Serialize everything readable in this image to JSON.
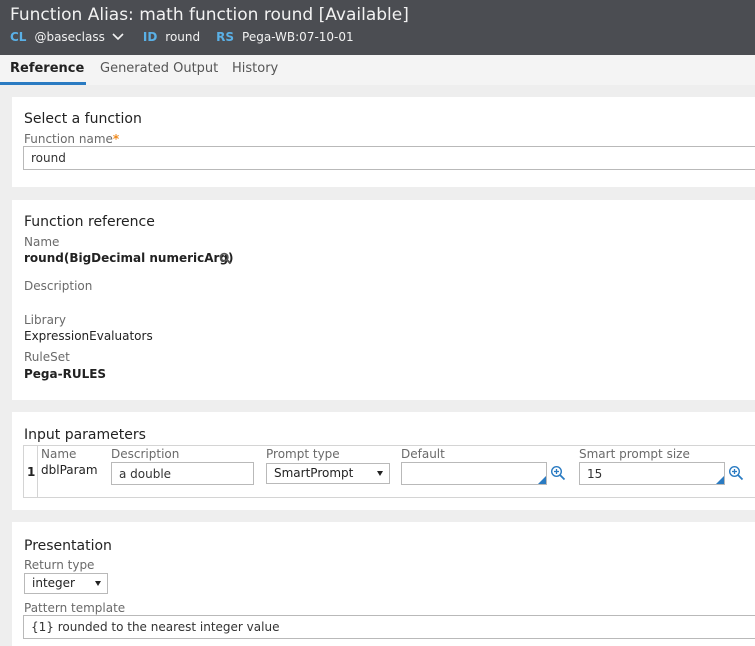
{
  "header": {
    "title": "Function Alias: math function round [Available]",
    "cl_key": "CL",
    "cl_value": "@baseclass",
    "id_key": "ID",
    "id_value": "round",
    "rs_key": "RS",
    "rs_value": "Pega-WB:07-10-01"
  },
  "tabs": [
    {
      "label": "Reference",
      "active": true
    },
    {
      "label": "Generated Output",
      "active": false
    },
    {
      "label": "History",
      "active": false
    }
  ],
  "select_function": {
    "title": "Select a function",
    "function_name_label": "Function name",
    "required_marker": "*",
    "function_name_value": "round"
  },
  "function_reference": {
    "title": "Function reference",
    "name_label": "Name",
    "name_value": "round(BigDecimal numericArg)",
    "description_label": "Description",
    "library_label": "Library",
    "library_value": "ExpressionEvaluators",
    "ruleset_label": "RuleSet",
    "ruleset_value": "Pega-RULES"
  },
  "input_parameters": {
    "title": "Input parameters",
    "columns": {
      "name": "Name",
      "description": "Description",
      "prompt_type": "Prompt type",
      "default": "Default",
      "smart_prompt_size": "Smart prompt size"
    },
    "rows": [
      {
        "index": "1",
        "name": "dblParam",
        "description": "a double",
        "prompt_type": "SmartPrompt",
        "default": "",
        "smart_prompt_size": "15"
      }
    ]
  },
  "presentation": {
    "title": "Presentation",
    "return_type_label": "Return type",
    "return_type_value": "integer",
    "pattern_template_label": "Pattern template",
    "pattern_template_value": "{1} rounded to the nearest integer value"
  },
  "colors": {
    "header_bg": "#4b4d52",
    "accent": "#2a7bc2",
    "key_blue": "#5ab0e6",
    "required": "#f08a1d"
  }
}
